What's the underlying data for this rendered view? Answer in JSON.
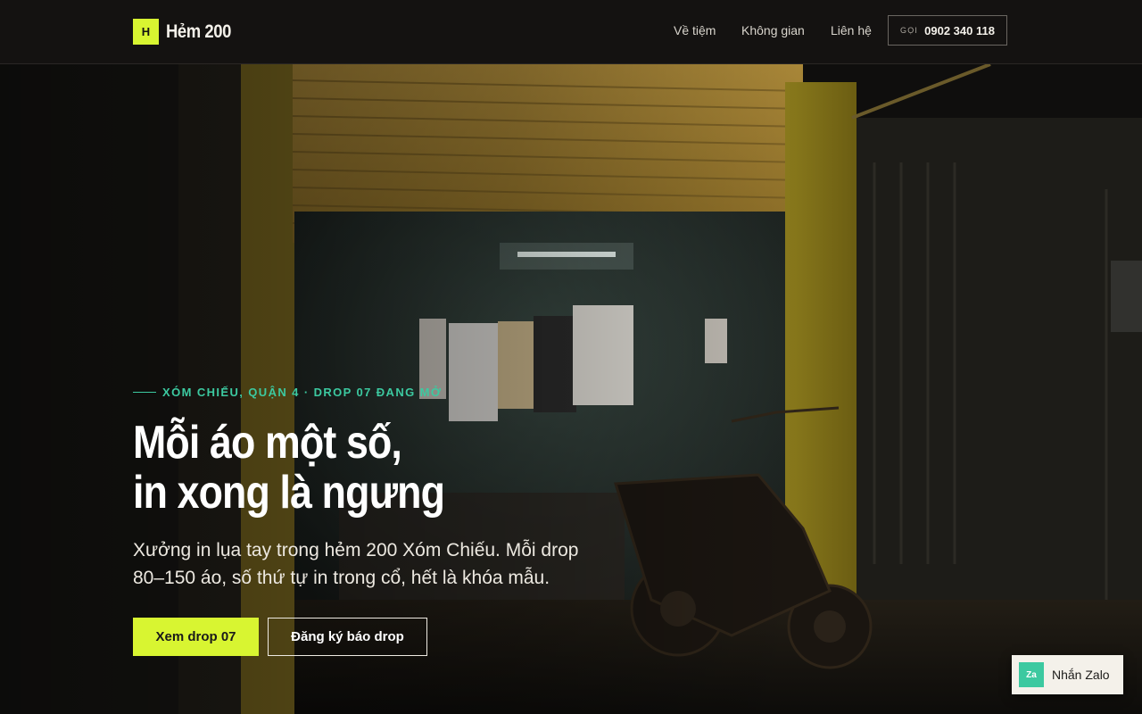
{
  "header": {
    "logo_letter": "H",
    "brand_name": "Hẻm 200",
    "nav": [
      {
        "label": "Về tiệm"
      },
      {
        "label": "Không gian"
      },
      {
        "label": "Liên hệ"
      }
    ],
    "call": {
      "label": "GỌI",
      "number": "0902 340 118"
    }
  },
  "hero": {
    "eyebrow": "Xóm Chiếu, Quận 4 · Drop 07 đang mở",
    "headline_line1": "Mỗi áo một số,",
    "headline_line2": "in xong là ngưng",
    "subtext": "Xưởng in lụa tay trong hẻm 200 Xóm Chiếu. Mỗi drop 80–150 áo, số thứ tự in trong cổ, hết là khóa mẫu.",
    "primary_cta": "Xem drop 07",
    "secondary_cta": "Đăng ký báo drop"
  },
  "floating": {
    "zalo_icon": "Za",
    "zalo_label": "Nhắn Zalo"
  },
  "colors": {
    "accent": "#d8f531",
    "teal": "#3cc9a0",
    "dark": "#141211"
  }
}
